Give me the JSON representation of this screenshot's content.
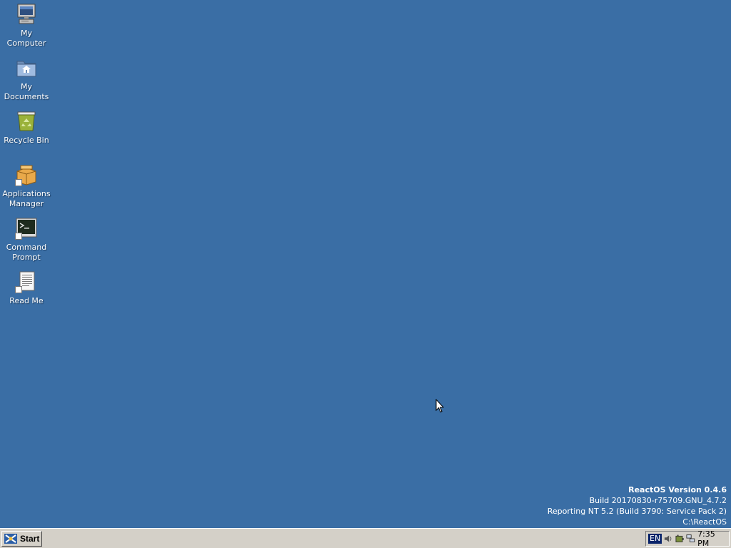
{
  "desktop": {
    "background_color": "#3a6ea5",
    "icons": [
      {
        "label": "My\nComputer",
        "icon": "computer-icon",
        "shortcut": false
      },
      {
        "label": "My\nDocuments",
        "icon": "documents-folder-icon",
        "shortcut": false
      },
      {
        "label": "Recycle Bin",
        "icon": "recycle-bin-icon",
        "shortcut": false
      },
      {
        "label": "Applications\nManager",
        "icon": "package-box-icon",
        "shortcut": true
      },
      {
        "label": "Command\nPrompt",
        "icon": "terminal-icon",
        "shortcut": true
      },
      {
        "label": "Read Me",
        "icon": "text-document-icon",
        "shortcut": true
      }
    ]
  },
  "version_info": {
    "title": "ReactOS Version 0.4.6",
    "build": "Build 20170830-r75709.GNU_4.7.2",
    "reporting": "Reporting NT 5.2 (Build 3790: Service Pack 2)",
    "path": "C:\\ReactOS"
  },
  "taskbar": {
    "start_label": "Start",
    "start_icon": "reactos-logo-icon",
    "tray": {
      "language": "EN",
      "icons": [
        "volume-icon",
        "battery-power-icon",
        "network-icon"
      ],
      "clock": "7:35 PM"
    }
  }
}
